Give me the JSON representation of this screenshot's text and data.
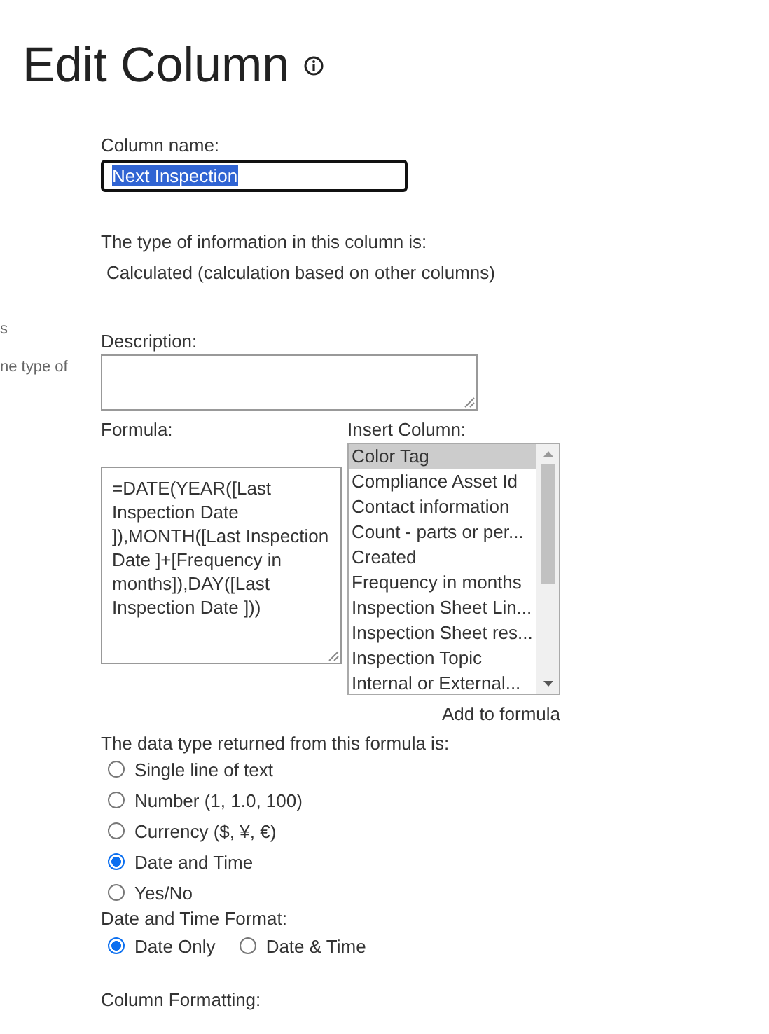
{
  "title": "Edit Column",
  "side_fragments": [
    "s",
    "ne type of"
  ],
  "column_name": {
    "label": "Column name:",
    "value": "Next Inspection",
    "text_selected": true
  },
  "type_info": {
    "label": "The type of information in this column is:",
    "value": "Calculated (calculation based on other columns)"
  },
  "description": {
    "label": "Description:"
  },
  "formula": {
    "label": "Formula:",
    "value": "=DATE(YEAR([Last Inspection Date ]),MONTH([Last Inspection Date ]+[Frequency in months]),DAY([Last Inspection Date ]))"
  },
  "insert_column": {
    "label": "Insert Column:",
    "items": [
      {
        "label": "Color Tag",
        "selected": true
      },
      {
        "label": "Compliance Asset Id",
        "selected": false
      },
      {
        "label": "Contact information",
        "selected": false
      },
      {
        "label": "Count - parts or per...",
        "selected": false
      },
      {
        "label": "Created",
        "selected": false
      },
      {
        "label": "Frequency in months",
        "selected": false
      },
      {
        "label": "Inspection Sheet Lin...",
        "selected": false
      },
      {
        "label": "Inspection Sheet res...",
        "selected": false
      },
      {
        "label": "Inspection Topic",
        "selected": false
      },
      {
        "label": "Internal or External...",
        "selected": false
      }
    ],
    "add_link": "Add to formula"
  },
  "data_type": {
    "label": "The data type returned from this formula is:",
    "options": [
      {
        "label": "Single line of text",
        "selected": false
      },
      {
        "label": "Number (1, 1.0, 100)",
        "selected": false
      },
      {
        "label": "Currency ($, ¥, €)",
        "selected": false
      },
      {
        "label": "Date and Time",
        "selected": true
      },
      {
        "label": "Yes/No",
        "selected": false
      }
    ]
  },
  "date_format": {
    "label": "Date and Time Format:",
    "options": [
      {
        "label": "Date Only",
        "selected": true
      },
      {
        "label": "Date & Time",
        "selected": false
      }
    ]
  },
  "column_formatting": {
    "label": "Column Formatting:"
  }
}
